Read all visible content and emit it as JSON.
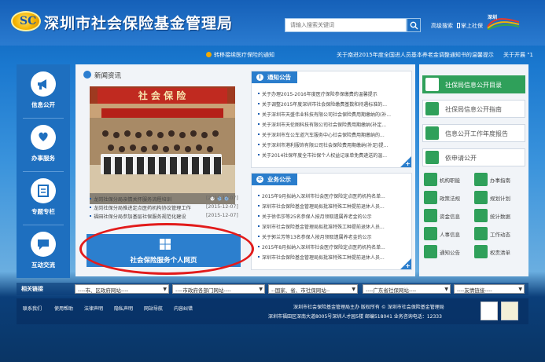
{
  "header": {
    "logo_text": "SC",
    "title": "深圳市社会保险基金管理局",
    "search_placeholder": "请输入搜索关键词",
    "link_advanced_search": "高级搜索",
    "link_mobile": "掌上社保",
    "right_logo_text": "深圳 来了就是深圳人"
  },
  "ticker": [
    "转移接续医疗保险的通知",
    "关于南进2015年度全国进人员基本养老金调整通知书的温馨提示",
    "关于开展 \"1"
  ],
  "left_nav": [
    {
      "label": "信息公开",
      "icon": "megaphone-icon"
    },
    {
      "label": "办事服务",
      "icon": "heart-hand-icon"
    },
    {
      "label": "专题专栏",
      "icon": "document-icon"
    },
    {
      "label": "互动交流",
      "icon": "chat-icon"
    }
  ],
  "news": {
    "title": "新闻资讯",
    "photo_banner": "社 会 保 险",
    "items": [
      {
        "text": "龙岗社保分局亲情关怀服务流程培训",
        "date": "[2015-12-07]"
      },
      {
        "text": "龙岗社保分局推进定点医药机构协议管理工作",
        "date": "[2015-12-07]"
      },
      {
        "text": "福田社保分局参加基层社保服务规范化建设",
        "date": "[2015-12-07]"
      }
    ]
  },
  "personal_tile": {
    "label": "社会保险服务个人网页"
  },
  "notice": {
    "title": "通知公告",
    "items": [
      "关于办理2015-2016年度医疗保险参保缴费的温馨提示",
      "关于调整2015年度深圳市社会保险缴费基数和待遇标准的...",
      "关于深圳市天盛伟业科技有限公司社会保险费用期缴纳的(补...",
      "关于深圳市天伦图科技有限公司社会保险费用期缴纳(补定...",
      "关于深圳市车公车道汽车服务中心社会保险费用期缴纳的...",
      "关于深圳市港利服饰有限公司社会保险费用期缴纳(补足)提...",
      "关于2014社保年度全市社保个人权益记录单免费递送的温..."
    ]
  },
  "business": {
    "title": "业务公示",
    "items": [
      "2015年9月拟纳入深圳市社会医疗保险定点医药机构名单...",
      "深圳市社会保险基金管理局拟批准特殊工种提前退休人员...",
      "关于徐伟莎等25名参保人按月领取遗属养老金的公示",
      "深圳市社会保险基金管理局拟批准特殊工种提前退休人员...",
      "关于郭兰芳等13名参保人按月领取遗属养老金的公示",
      "2015年8月拟纳入深圳市社会医疗保险定点医药机构名单...",
      "深圳市社会保险基金管理局拟批准特殊工种提前退休人员..."
    ]
  },
  "right_panel": {
    "buttons": [
      "社保局信息公开目录",
      "社保局信息公开指南",
      "信息公开工作年度报告",
      "依申请公开"
    ],
    "grid": [
      "机构职能",
      "办事指南",
      "政策法规",
      "规划计划",
      "资金信息",
      "统计数据",
      "人事信息",
      "工作动态",
      "通知公告",
      "权责清单"
    ]
  },
  "links_bar": {
    "label": "相关链接",
    "selects": [
      "----市、区政府网站----",
      "----市政府各部门网站----",
      "--国家、省、市社保网站--",
      "----广东省社保网站----",
      "----友情链接----"
    ]
  },
  "footer": {
    "links": [
      "联系我们",
      "使用帮助",
      "法律声明",
      "隐私声明",
      "网站导航",
      "内容纠错"
    ],
    "line1": "深圳市社会保险基金管理局主办 版权所有 © 深圳市社会保险基金管理局",
    "line2": "深圳市福田区深南大道8005号深圳人才园5楼   邮编518041  业务咨询电话：12333"
  },
  "colors": {
    "primary_blue": "#2a7dcc",
    "accent_green": "#2fa05a",
    "highlight_red": "#e21b1b"
  }
}
